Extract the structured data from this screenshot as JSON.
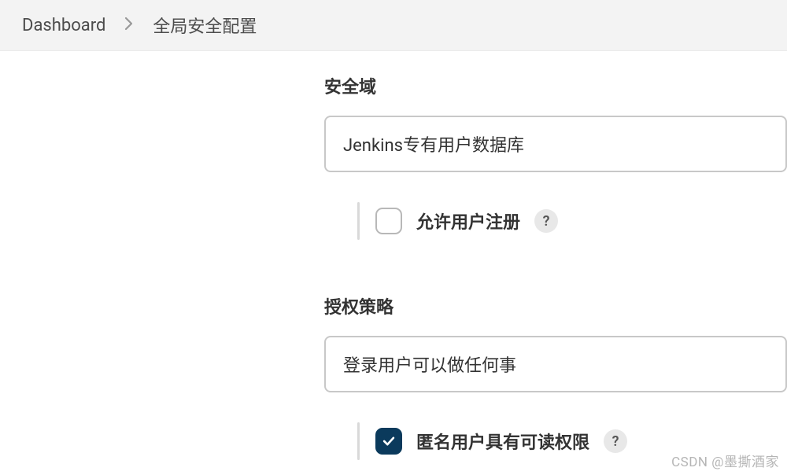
{
  "breadcrumb": {
    "root": "Dashboard",
    "current": "全局安全配置"
  },
  "security_realm": {
    "label": "安全域",
    "selected": "Jenkins专有用户数据库",
    "allow_signup_label": "允许用户注册",
    "allow_signup_checked": false
  },
  "authorization": {
    "label": "授权策略",
    "selected": "登录用户可以做任何事",
    "anonymous_read_label": "匿名用户具有可读权限",
    "anonymous_read_checked": true
  },
  "help_symbol": "?",
  "watermark": "CSDN @墨撕酒家"
}
